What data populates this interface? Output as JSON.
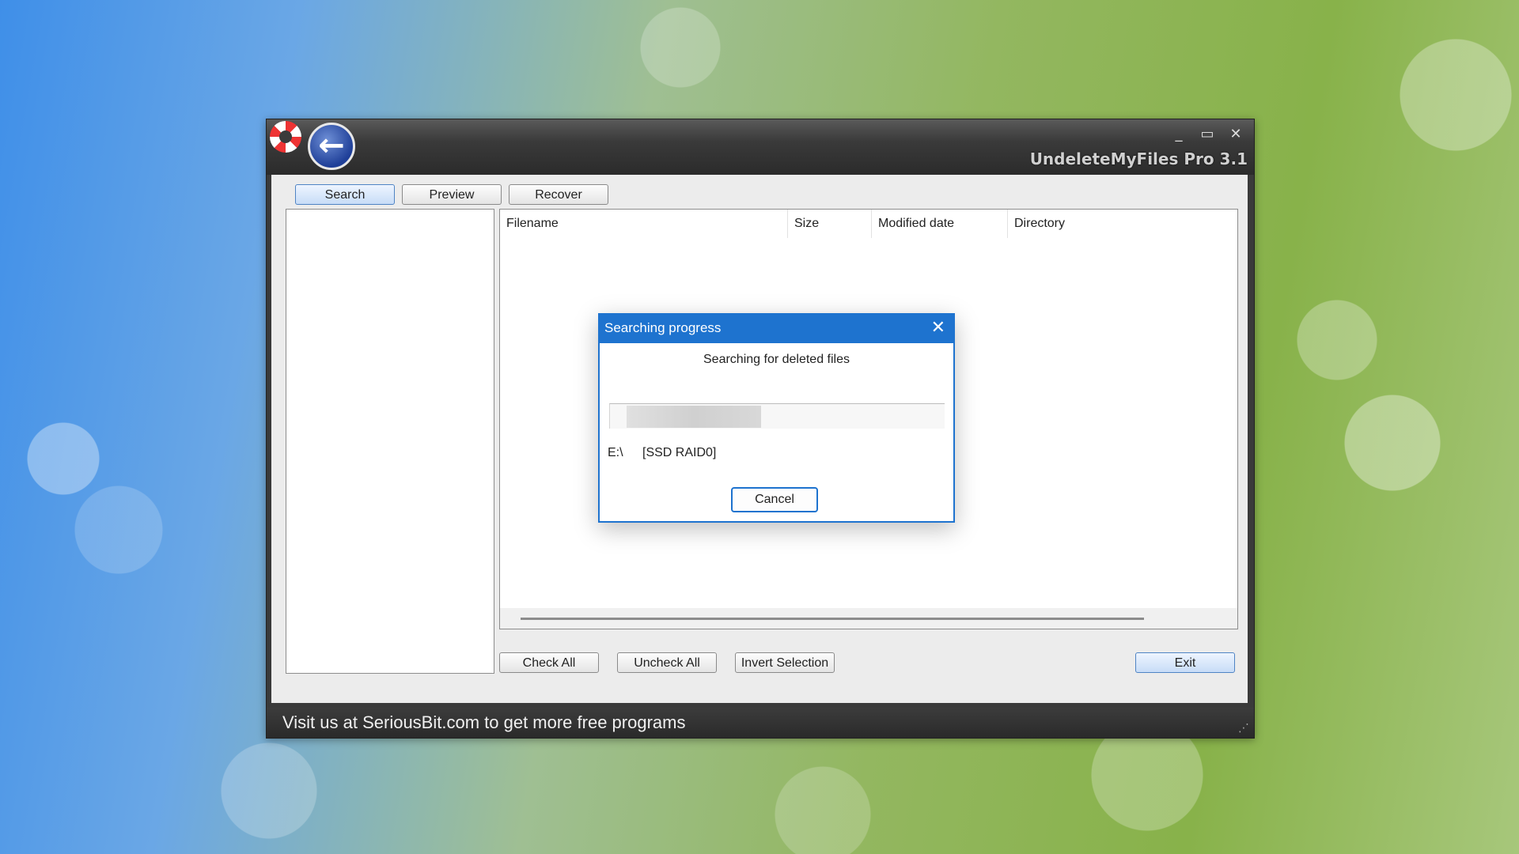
{
  "app": {
    "title": "UndeleteMyFiles Pro 3.1",
    "window_controls": {
      "minimize": "_",
      "maximize": "▭",
      "close": "✕"
    },
    "back_icon": "back-arrow-icon",
    "logo_icon": "lifebuoy-icon"
  },
  "tabs": [
    {
      "label": "Search",
      "active": true
    },
    {
      "label": "Preview",
      "active": false
    },
    {
      "label": "Recover",
      "active": false
    }
  ],
  "table": {
    "columns": [
      "Filename",
      "Size",
      "Modified date",
      "Directory"
    ],
    "rows": []
  },
  "bottom_buttons": {
    "check_all": "Check All",
    "uncheck_all": "Uncheck All",
    "invert_selection": "Invert Selection",
    "exit": "Exit"
  },
  "status": {
    "text": "Visit us at SeriousBit.com to get more free programs"
  },
  "dialog": {
    "title": "Searching progress",
    "message": "Searching for deleted files",
    "progress": {
      "start": 0.05,
      "end": 0.45
    },
    "drive_path": "E:\\",
    "drive_label": "[SSD RAID0]",
    "cancel_label": "Cancel",
    "close_glyph": "✕"
  },
  "colors": {
    "accent": "#1e73cf",
    "titlebar": "#3a3a3a"
  }
}
